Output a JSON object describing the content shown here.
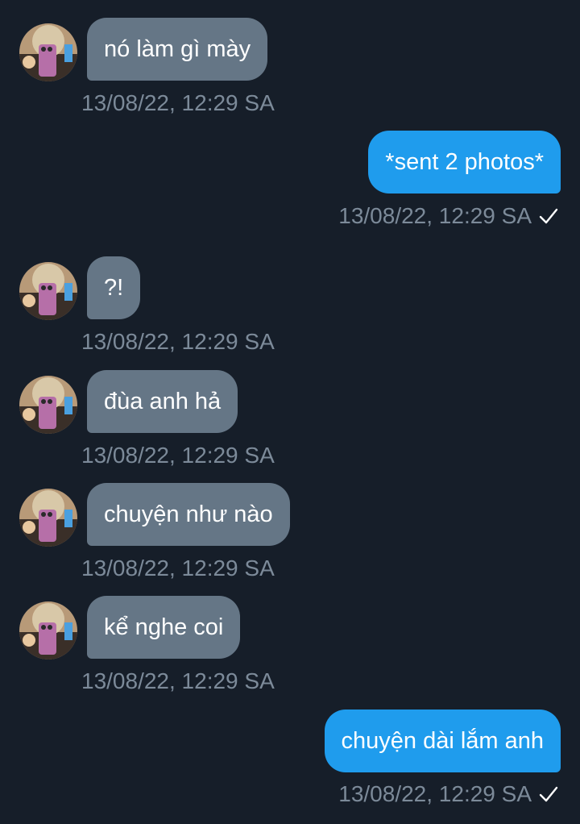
{
  "messages": [
    {
      "direction": "in",
      "text": "nó làm gì mày",
      "time": "13/08/22, 12:29 SA"
    },
    {
      "direction": "out",
      "text": "*sent 2 photos*",
      "time": "13/08/22, 12:29 SA",
      "status_icon": "check-icon"
    },
    {
      "direction": "in",
      "text": "?!",
      "time": "13/08/22, 12:29 SA"
    },
    {
      "direction": "in",
      "text": "đùa anh hả",
      "time": "13/08/22, 12:29 SA"
    },
    {
      "direction": "in",
      "text": "chuyện như nào",
      "time": "13/08/22, 12:29 SA"
    },
    {
      "direction": "in",
      "text": "kể nghe coi",
      "time": "13/08/22, 12:29 SA"
    },
    {
      "direction": "out",
      "text": "chuyện dài lắm anh",
      "time": "13/08/22, 12:29 SA",
      "status_icon": "check-icon"
    }
  ],
  "colors": {
    "background": "#161e29",
    "incoming_bubble": "#657686",
    "outgoing_bubble": "#1f9ced",
    "timestamp": "#7c8a99"
  }
}
